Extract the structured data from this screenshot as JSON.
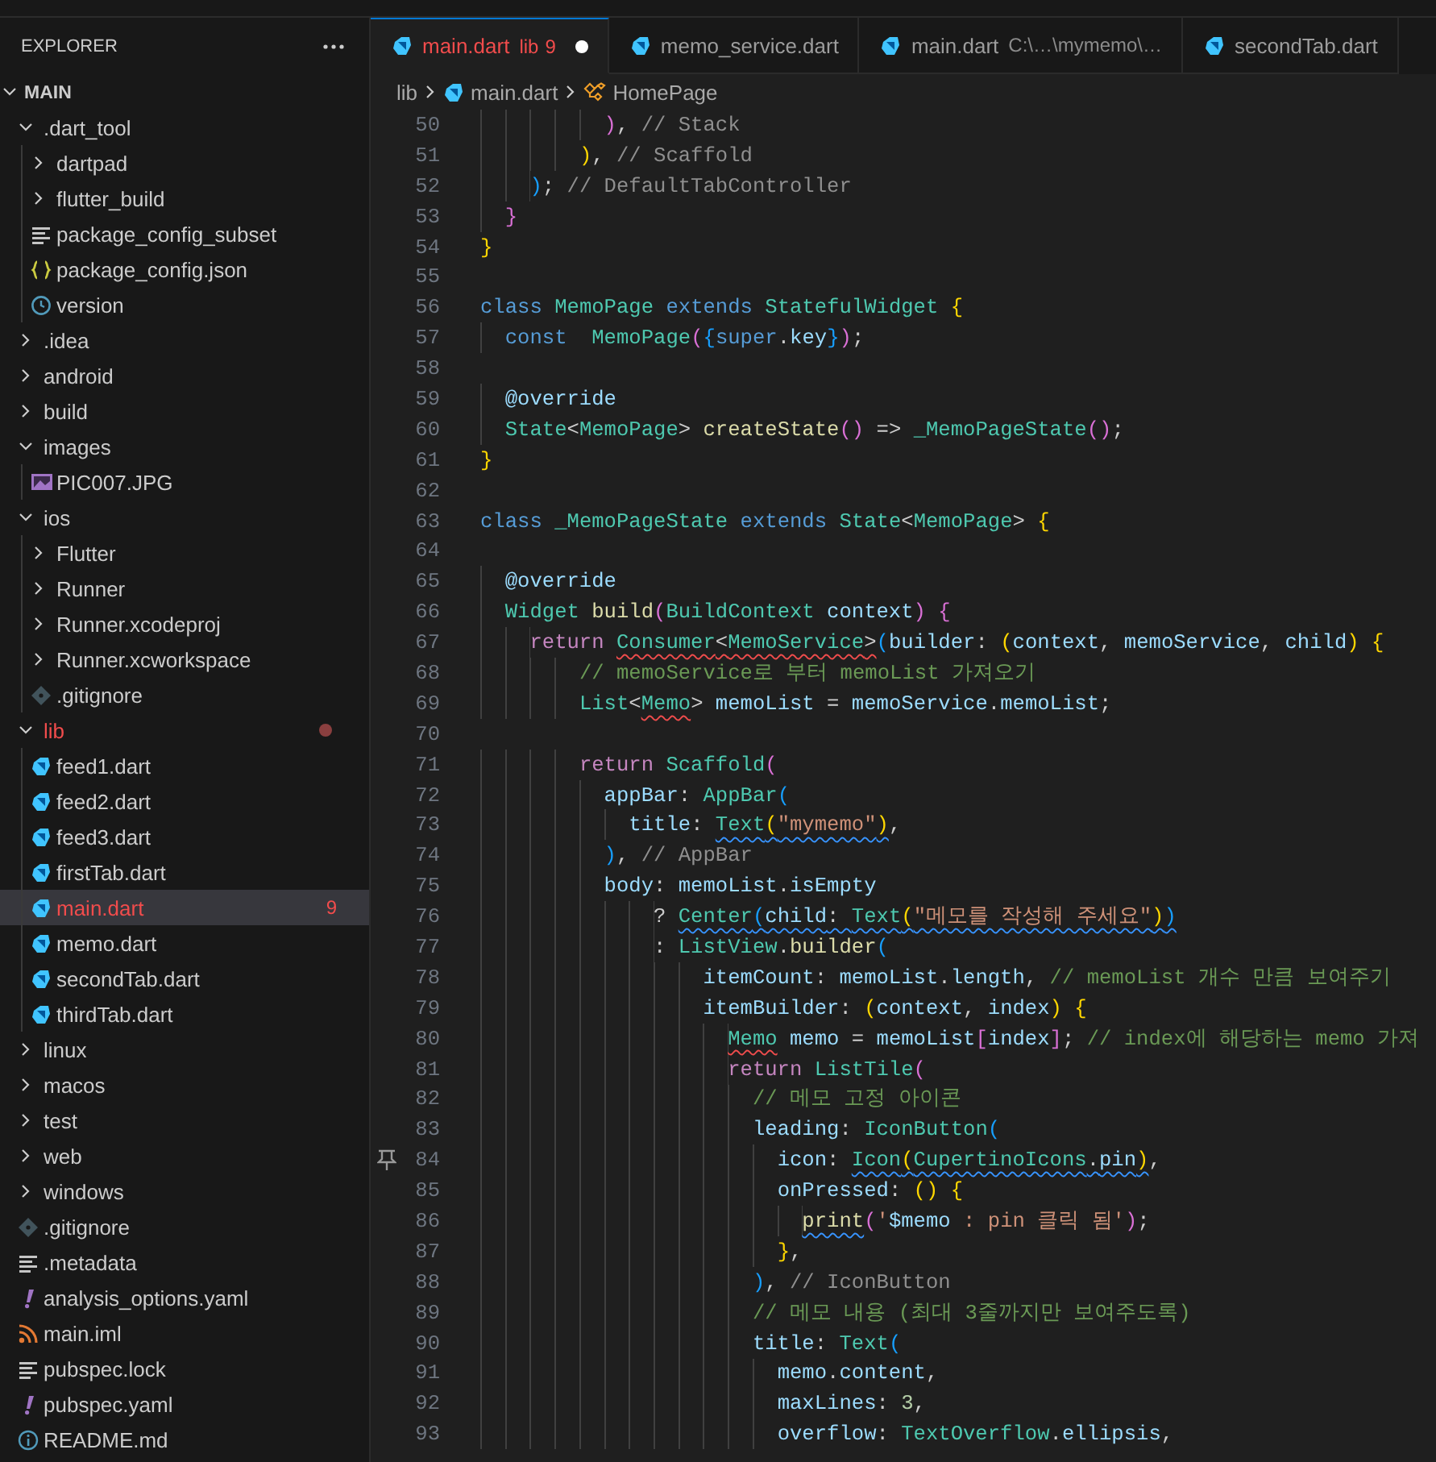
{
  "explorer": {
    "title": "EXPLORER",
    "section": {
      "label": "MAIN",
      "expanded": true
    },
    "items": [
      {
        "label": ".dart_tool",
        "kind": "folder",
        "expanded": true,
        "selected": false,
        "children": [
          {
            "label": "dartpad",
            "kind": "folder",
            "expanded": false,
            "selected": false
          },
          {
            "label": "flutter_build",
            "kind": "folder",
            "expanded": false,
            "selected": false
          },
          {
            "label": "package_config_subset",
            "kind": "text",
            "selected": false
          },
          {
            "label": "package_config.json",
            "kind": "json",
            "selected": false
          },
          {
            "label": "version",
            "kind": "clock",
            "selected": false
          }
        ]
      },
      {
        "label": ".idea",
        "kind": "folder",
        "expanded": false,
        "selected": false
      },
      {
        "label": "android",
        "kind": "folder",
        "expanded": false,
        "selected": false
      },
      {
        "label": "build",
        "kind": "folder",
        "expanded": false,
        "selected": false
      },
      {
        "label": "images",
        "kind": "folder",
        "expanded": true,
        "selected": false,
        "children": [
          {
            "label": "PIC007.JPG",
            "kind": "image",
            "selected": false
          }
        ]
      },
      {
        "label": "ios",
        "kind": "folder",
        "expanded": true,
        "selected": false,
        "children": [
          {
            "label": "Flutter",
            "kind": "folder",
            "expanded": false,
            "selected": false
          },
          {
            "label": "Runner",
            "kind": "folder",
            "expanded": false,
            "selected": false
          },
          {
            "label": "Runner.xcodeproj",
            "kind": "folder",
            "expanded": false,
            "selected": false
          },
          {
            "label": "Runner.xcworkspace",
            "kind": "folder",
            "expanded": false,
            "selected": false
          },
          {
            "label": ".gitignore",
            "kind": "git",
            "selected": false
          }
        ]
      },
      {
        "label": "lib",
        "kind": "folder",
        "expanded": true,
        "selected": false,
        "error": true,
        "dot": true,
        "children": [
          {
            "label": "feed1.dart",
            "kind": "dart",
            "selected": false
          },
          {
            "label": "feed2.dart",
            "kind": "dart",
            "selected": false
          },
          {
            "label": "feed3.dart",
            "kind": "dart",
            "selected": false
          },
          {
            "label": "firstTab.dart",
            "kind": "dart",
            "selected": false
          },
          {
            "label": "main.dart",
            "kind": "dart",
            "selected": true,
            "error": true,
            "badge": "9"
          },
          {
            "label": "memo.dart",
            "kind": "dart",
            "selected": false
          },
          {
            "label": "secondTab.dart",
            "kind": "dart",
            "selected": false
          },
          {
            "label": "thirdTab.dart",
            "kind": "dart",
            "selected": false
          }
        ]
      },
      {
        "label": "linux",
        "kind": "folder",
        "expanded": false,
        "selected": false
      },
      {
        "label": "macos",
        "kind": "folder",
        "expanded": false,
        "selected": false
      },
      {
        "label": "test",
        "kind": "folder",
        "expanded": false,
        "selected": false
      },
      {
        "label": "web",
        "kind": "folder",
        "expanded": false,
        "selected": false
      },
      {
        "label": "windows",
        "kind": "folder",
        "expanded": false,
        "selected": false
      },
      {
        "label": ".gitignore",
        "kind": "git",
        "selected": false
      },
      {
        "label": ".metadata",
        "kind": "text",
        "selected": false
      },
      {
        "label": "analysis_options.yaml",
        "kind": "yaml",
        "selected": false
      },
      {
        "label": "main.iml",
        "kind": "rss",
        "selected": false
      },
      {
        "label": "pubspec.lock",
        "kind": "text",
        "selected": false
      },
      {
        "label": "pubspec.yaml",
        "kind": "yaml",
        "selected": false
      },
      {
        "label": "README.md",
        "kind": "info",
        "selected": false
      }
    ]
  },
  "tabs": [
    {
      "label": "main.dart",
      "description": "lib",
      "badge": "9",
      "modified": true,
      "error": true,
      "selected": true
    },
    {
      "label": "memo_service.dart",
      "selected": false
    },
    {
      "label": "main.dart",
      "description": "C:\\…\\mymemo\\…",
      "selected": false
    },
    {
      "label": "secondTab.dart",
      "selected": false
    }
  ],
  "breadcrumb": [
    {
      "label": "lib",
      "kind": "folder"
    },
    {
      "label": "main.dart",
      "kind": "dart"
    },
    {
      "label": "HomePage",
      "kind": "class"
    }
  ],
  "editor": {
    "lines": [
      {
        "number": "50",
        "tokens": [
          {
            "text": "          )",
            "kind": "b2"
          },
          {
            "text": ", ",
            "kind": "p"
          },
          {
            "text": "// Stack",
            "kind": "lbl"
          }
        ]
      },
      {
        "number": "51",
        "tokens": [
          {
            "text": "        )",
            "kind": "b1"
          },
          {
            "text": ", ",
            "kind": "p"
          },
          {
            "text": "// Scaffold",
            "kind": "lbl"
          }
        ]
      },
      {
        "number": "52",
        "tokens": [
          {
            "text": "    )",
            "kind": "b3"
          },
          {
            "text": "; ",
            "kind": "p"
          },
          {
            "text": "// DefaultTabController",
            "kind": "lbl"
          }
        ]
      },
      {
        "number": "53",
        "tokens": [
          {
            "text": "  }",
            "kind": "b2"
          }
        ]
      },
      {
        "number": "54",
        "tokens": [
          {
            "text": "}",
            "kind": "b1"
          }
        ]
      },
      {
        "number": "55"
      },
      {
        "number": "56",
        "tokens": [
          {
            "text": "class",
            "kind": "kw"
          },
          {
            "text": " MemoPage",
            "kind": "type"
          },
          {
            "text": " extends",
            "kind": "kw"
          },
          {
            "text": " StatefulWidget",
            "kind": "type"
          },
          {
            "text": " {",
            "kind": "b1"
          }
        ]
      },
      {
        "number": "57",
        "tokens": [
          {
            "text": "  const",
            "kind": "kw"
          },
          {
            "text": "  MemoPage",
            "kind": "type"
          },
          {
            "text": "(",
            "kind": "b2"
          },
          {
            "text": "{",
            "kind": "b3"
          },
          {
            "text": "super",
            "kind": "kw"
          },
          {
            "text": ".",
            "kind": "p"
          },
          {
            "text": "key",
            "kind": "var"
          },
          {
            "text": "}",
            "kind": "b3"
          },
          {
            "text": ")",
            "kind": "b2"
          },
          {
            "text": ";",
            "kind": "p"
          }
        ]
      },
      {
        "number": "58"
      },
      {
        "number": "59",
        "tokens": [
          {
            "text": "  @override",
            "kind": "var"
          }
        ]
      },
      {
        "number": "60",
        "tokens": [
          {
            "text": "  State",
            "kind": "type"
          },
          {
            "text": "<",
            "kind": "p"
          },
          {
            "text": "MemoPage",
            "kind": "type"
          },
          {
            "text": "> ",
            "kind": "p"
          },
          {
            "text": "createState",
            "kind": "fn"
          },
          {
            "text": "()",
            "kind": "b2"
          },
          {
            "text": " => ",
            "kind": "p"
          },
          {
            "text": "_MemoPageState",
            "kind": "type"
          },
          {
            "text": "()",
            "kind": "b2"
          },
          {
            "text": ";",
            "kind": "p"
          }
        ]
      },
      {
        "number": "61",
        "tokens": [
          {
            "text": "}",
            "kind": "b1"
          }
        ]
      },
      {
        "number": "62"
      },
      {
        "number": "63",
        "tokens": [
          {
            "text": "class",
            "kind": "kw"
          },
          {
            "text": " _MemoPageState",
            "kind": "type"
          },
          {
            "text": " extends",
            "kind": "kw"
          },
          {
            "text": " State",
            "kind": "type"
          },
          {
            "text": "<",
            "kind": "p"
          },
          {
            "text": "MemoPage",
            "kind": "type"
          },
          {
            "text": ">",
            "kind": "p"
          },
          {
            "text": " {",
            "kind": "b1"
          }
        ]
      },
      {
        "number": "64"
      },
      {
        "number": "65",
        "tokens": [
          {
            "text": "  @override",
            "kind": "var"
          }
        ]
      },
      {
        "number": "66",
        "tokens": [
          {
            "text": "  Widget",
            "kind": "type"
          },
          {
            "text": " build",
            "kind": "fn"
          },
          {
            "text": "(",
            "kind": "b2"
          },
          {
            "text": "BuildContext",
            "kind": "type"
          },
          {
            "text": " context",
            "kind": "var"
          },
          {
            "text": ")",
            "kind": "b2"
          },
          {
            "text": " {",
            "kind": "b2"
          }
        ]
      },
      {
        "number": "67",
        "tokens": [
          {
            "text": "    return ",
            "kind": "ctl"
          },
          {
            "text": "Consumer",
            "kind": "type",
            "error_squiggle": true
          },
          {
            "text": "<",
            "kind": "p",
            "error_squiggle": true
          },
          {
            "text": "MemoService",
            "kind": "type",
            "error_squiggle": true
          },
          {
            "text": ">",
            "kind": "p",
            "error_squiggle": true
          },
          {
            "text": "(",
            "kind": "b3"
          },
          {
            "text": "builder",
            "kind": "var"
          },
          {
            "text": ": ",
            "kind": "p"
          },
          {
            "text": "(",
            "kind": "b1"
          },
          {
            "text": "context",
            "kind": "var"
          },
          {
            "text": ", ",
            "kind": "p"
          },
          {
            "text": "memoService",
            "kind": "var"
          },
          {
            "text": ", ",
            "kind": "p"
          },
          {
            "text": "child",
            "kind": "var"
          },
          {
            "text": ")",
            "kind": "b1"
          },
          {
            "text": " {",
            "kind": "b1"
          }
        ]
      },
      {
        "number": "68",
        "tokens": [
          {
            "text": "        // memoService로 부터 memoList 가져오기",
            "kind": "cm"
          }
        ]
      },
      {
        "number": "69",
        "tokens": [
          {
            "text": "        List",
            "kind": "type"
          },
          {
            "text": "<",
            "kind": "p"
          },
          {
            "text": "Memo",
            "kind": "type",
            "error_squiggle": true
          },
          {
            "text": ">",
            "kind": "p"
          },
          {
            "text": " memoList",
            "kind": "var"
          },
          {
            "text": " = ",
            "kind": "p"
          },
          {
            "text": "memoService",
            "kind": "var"
          },
          {
            "text": ".",
            "kind": "p"
          },
          {
            "text": "memoList",
            "kind": "var"
          },
          {
            "text": ";",
            "kind": "p"
          }
        ]
      },
      {
        "number": "70"
      },
      {
        "number": "71",
        "tokens": [
          {
            "text": "        return",
            "kind": "ctl"
          },
          {
            "text": " Scaffold",
            "kind": "type"
          },
          {
            "text": "(",
            "kind": "b2"
          }
        ]
      },
      {
        "number": "72",
        "tokens": [
          {
            "text": "          appBar",
            "kind": "var"
          },
          {
            "text": ": ",
            "kind": "p"
          },
          {
            "text": "AppBar",
            "kind": "type"
          },
          {
            "text": "(",
            "kind": "b3"
          }
        ]
      },
      {
        "number": "73",
        "tokens": [
          {
            "text": "            title",
            "kind": "var"
          },
          {
            "text": ": ",
            "kind": "p"
          },
          {
            "text": "Text",
            "kind": "type",
            "info_squiggle": true
          },
          {
            "text": "(",
            "kind": "b1",
            "info_squiggle": true
          },
          {
            "text": "\"mymemo\"",
            "kind": "str",
            "info_squiggle": true
          },
          {
            "text": ")",
            "kind": "b1",
            "info_squiggle": true
          },
          {
            "text": ",",
            "kind": "p"
          }
        ]
      },
      {
        "number": "74",
        "tokens": [
          {
            "text": "          )",
            "kind": "b3"
          },
          {
            "text": ", ",
            "kind": "p"
          },
          {
            "text": "// AppBar",
            "kind": "lbl"
          }
        ]
      },
      {
        "number": "75",
        "tokens": [
          {
            "text": "          body",
            "kind": "var"
          },
          {
            "text": ": ",
            "kind": "p"
          },
          {
            "text": "memoList",
            "kind": "var"
          },
          {
            "text": ".",
            "kind": "p"
          },
          {
            "text": "isEmpty",
            "kind": "var"
          }
        ]
      },
      {
        "number": "76",
        "tokens": [
          {
            "text": "              ? ",
            "kind": "p"
          },
          {
            "text": "Center",
            "kind": "type",
            "info_squiggle": true
          },
          {
            "text": "(",
            "kind": "b3",
            "info_squiggle": true
          },
          {
            "text": "child",
            "kind": "var",
            "info_squiggle": true
          },
          {
            "text": ": ",
            "kind": "p",
            "info_squiggle": true
          },
          {
            "text": "Text",
            "kind": "type",
            "info_squiggle": true
          },
          {
            "text": "(",
            "kind": "b1",
            "info_squiggle": true
          },
          {
            "text": "\"메모를 작성해 주세요\"",
            "kind": "str",
            "info_squiggle": true
          },
          {
            "text": ")",
            "kind": "b1",
            "info_squiggle": true
          },
          {
            "text": ")",
            "kind": "b3",
            "info_squiggle": true
          }
        ]
      },
      {
        "number": "77",
        "tokens": [
          {
            "text": "              : ",
            "kind": "p"
          },
          {
            "text": "ListView",
            "kind": "type"
          },
          {
            "text": ".",
            "kind": "p"
          },
          {
            "text": "builder",
            "kind": "fn"
          },
          {
            "text": "(",
            "kind": "b3"
          }
        ]
      },
      {
        "number": "78",
        "tokens": [
          {
            "text": "                  itemCount",
            "kind": "var"
          },
          {
            "text": ": ",
            "kind": "p"
          },
          {
            "text": "memoList",
            "kind": "var"
          },
          {
            "text": ".",
            "kind": "p"
          },
          {
            "text": "length",
            "kind": "var"
          },
          {
            "text": ", ",
            "kind": "p"
          },
          {
            "text": "// memoList 개수 만큼 보여주기",
            "kind": "cm"
          }
        ]
      },
      {
        "number": "79",
        "tokens": [
          {
            "text": "                  itemBuilder",
            "kind": "var"
          },
          {
            "text": ": ",
            "kind": "p"
          },
          {
            "text": "(",
            "kind": "b1"
          },
          {
            "text": "context",
            "kind": "var"
          },
          {
            "text": ", ",
            "kind": "p"
          },
          {
            "text": "index",
            "kind": "var"
          },
          {
            "text": ")",
            "kind": "b1"
          },
          {
            "text": " {",
            "kind": "b1"
          }
        ]
      },
      {
        "number": "80",
        "tokens": [
          {
            "text": "                    Memo",
            "kind": "type",
            "error_squiggle": true
          },
          {
            "text": " memo",
            "kind": "var"
          },
          {
            "text": " = ",
            "kind": "p"
          },
          {
            "text": "memoList",
            "kind": "var"
          },
          {
            "text": "[",
            "kind": "b2"
          },
          {
            "text": "index",
            "kind": "var"
          },
          {
            "text": "]",
            "kind": "b2"
          },
          {
            "text": "; ",
            "kind": "p"
          },
          {
            "text": "// index에 해당하는 memo 가져",
            "kind": "cm"
          }
        ]
      },
      {
        "number": "81",
        "tokens": [
          {
            "text": "                    return",
            "kind": "ctl"
          },
          {
            "text": " ListTile",
            "kind": "type"
          },
          {
            "text": "(",
            "kind": "b2"
          }
        ]
      },
      {
        "number": "82",
        "tokens": [
          {
            "text": "                      // 메모 고정 아이콘",
            "kind": "cm"
          }
        ]
      },
      {
        "number": "83",
        "tokens": [
          {
            "text": "                      leading",
            "kind": "var"
          },
          {
            "text": ": ",
            "kind": "p"
          },
          {
            "text": "IconButton",
            "kind": "type"
          },
          {
            "text": "(",
            "kind": "b3"
          }
        ]
      },
      {
        "number": "84",
        "pinned": true,
        "tokens": [
          {
            "text": "                        icon",
            "kind": "var"
          },
          {
            "text": ": ",
            "kind": "p"
          },
          {
            "text": "Icon",
            "kind": "type",
            "info_squiggle": true
          },
          {
            "text": "(",
            "kind": "b1",
            "info_squiggle": true
          },
          {
            "text": "CupertinoIcons",
            "kind": "type",
            "info_squiggle": true
          },
          {
            "text": ".",
            "kind": "p",
            "info_squiggle": true
          },
          {
            "text": "pin",
            "kind": "var",
            "info_squiggle": true
          },
          {
            "text": ")",
            "kind": "b1",
            "info_squiggle": true
          },
          {
            "text": ",",
            "kind": "p"
          }
        ]
      },
      {
        "number": "85",
        "tokens": [
          {
            "text": "                        onPressed",
            "kind": "var"
          },
          {
            "text": ": ",
            "kind": "p"
          },
          {
            "text": "()",
            "kind": "b1"
          },
          {
            "text": " {",
            "kind": "b1"
          }
        ]
      },
      {
        "number": "86",
        "tokens": [
          {
            "text": "                          print",
            "kind": "fn",
            "info_squiggle": true
          },
          {
            "text": "(",
            "kind": "b2"
          },
          {
            "text": "'",
            "kind": "str"
          },
          {
            "text": "$memo",
            "kind": "var"
          },
          {
            "text": " : pin 클릭 됨'",
            "kind": "str"
          },
          {
            "text": ")",
            "kind": "b2"
          },
          {
            "text": ";",
            "kind": "p"
          }
        ]
      },
      {
        "number": "87",
        "tokens": [
          {
            "text": "                        }",
            "kind": "b1"
          },
          {
            "text": ",",
            "kind": "p"
          }
        ]
      },
      {
        "number": "88",
        "tokens": [
          {
            "text": "                      )",
            "kind": "b3"
          },
          {
            "text": ", ",
            "kind": "p"
          },
          {
            "text": "// IconButton",
            "kind": "lbl"
          }
        ]
      },
      {
        "number": "89",
        "tokens": [
          {
            "text": "                      // 메모 내용 (최대 3줄까지만 보여주도록)",
            "kind": "cm"
          }
        ]
      },
      {
        "number": "90",
        "tokens": [
          {
            "text": "                      title",
            "kind": "var"
          },
          {
            "text": ": ",
            "kind": "p"
          },
          {
            "text": "Text",
            "kind": "type"
          },
          {
            "text": "(",
            "kind": "b3"
          }
        ]
      },
      {
        "number": "91",
        "tokens": [
          {
            "text": "                        memo",
            "kind": "var"
          },
          {
            "text": ".",
            "kind": "p"
          },
          {
            "text": "content",
            "kind": "var"
          },
          {
            "text": ",",
            "kind": "p"
          }
        ]
      },
      {
        "number": "92",
        "tokens": [
          {
            "text": "                        maxLines",
            "kind": "var"
          },
          {
            "text": ": ",
            "kind": "p"
          },
          {
            "text": "3",
            "kind": "num"
          },
          {
            "text": ",",
            "kind": "p"
          }
        ]
      },
      {
        "number": "93",
        "tokens": [
          {
            "text": "                        overflow",
            "kind": "var"
          },
          {
            "text": ": ",
            "kind": "p"
          },
          {
            "text": "TextOverflow",
            "kind": "type"
          },
          {
            "text": ".",
            "kind": "p"
          },
          {
            "text": "ellipsis",
            "kind": "var"
          },
          {
            "text": ",",
            "kind": "p"
          }
        ]
      }
    ]
  }
}
